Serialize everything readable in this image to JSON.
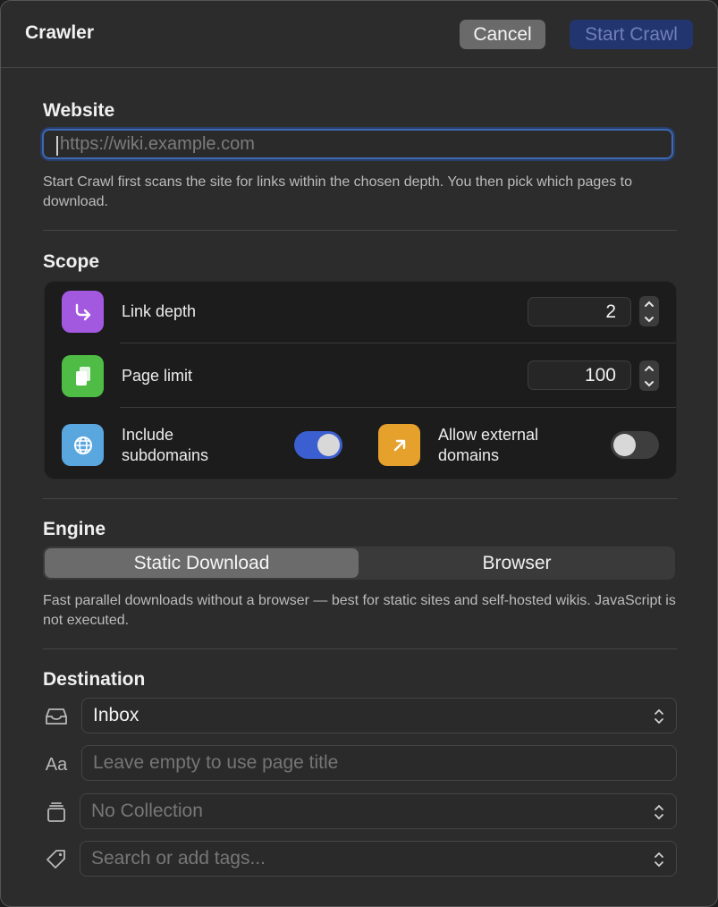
{
  "window": {
    "title": "Crawler",
    "cancel_label": "Cancel",
    "start_label": "Start Crawl"
  },
  "website": {
    "section_title": "Website",
    "placeholder": "https://wiki.example.com",
    "value": "",
    "helper": "Start Crawl first scans the site for links within the chosen depth. You then pick which pages to download."
  },
  "scope": {
    "section_title": "Scope",
    "link_depth": {
      "label": "Link depth",
      "value": "2",
      "icon": "return-arrow-icon",
      "icon_color": "#a259e0"
    },
    "page_limit": {
      "label": "Page limit",
      "value": "100",
      "icon": "documents-icon",
      "icon_color": "#4fbd45"
    },
    "include_subdomains": {
      "label_line1": "Include",
      "label_line2": "subdomains",
      "enabled": true,
      "icon": "globe-icon",
      "icon_color": "#5aa7e0"
    },
    "allow_external": {
      "label_line1": "Allow external",
      "label_line2": "domains",
      "enabled": false,
      "icon": "arrow-up-right-icon",
      "icon_color": "#e6a12c"
    }
  },
  "engine": {
    "section_title": "Engine",
    "options": [
      "Static Download",
      "Browser"
    ],
    "selected": "Static Download",
    "helper": "Fast parallel downloads without a browser — best for static sites and self-hosted wikis. JavaScript is not executed."
  },
  "destination": {
    "section_title": "Destination",
    "inbox_value": "Inbox",
    "title_placeholder": "Leave empty to use page title",
    "collection_value": "No Collection",
    "tags_placeholder": "Search or add tags...",
    "title_icon_text": "Aa"
  },
  "colors": {
    "accent": "#3b5fd0",
    "primary_button_disabled": "#22356f"
  }
}
